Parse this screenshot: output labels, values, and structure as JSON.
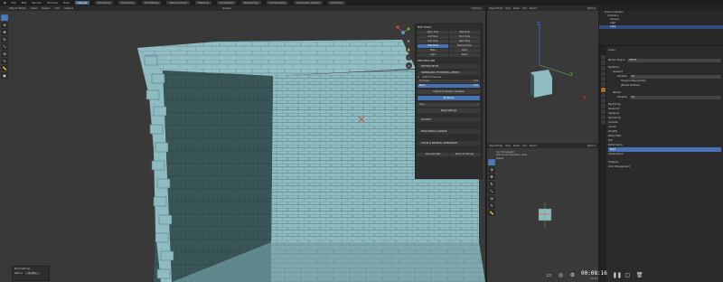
{
  "menubar": {
    "items": [
      "File",
      "Edit",
      "Render",
      "Window",
      "Help"
    ],
    "workspaces": [
      "Layout",
      "Modeling",
      "Sculpting",
      "UV Editing",
      "Texture Paint",
      "Shading",
      "Animation",
      "Rendering",
      "Compositing",
      "Geometry Nodes",
      "Scripting"
    ],
    "active_workspace": "Layout"
  },
  "viewport_main": {
    "mode": "Object Mode",
    "menus": [
      "View",
      "Select",
      "Add",
      "Object"
    ],
    "orientation": "Global",
    "options": "Options"
  },
  "npanel": {
    "title": "MAP TOOLS",
    "tool_buttons": [
      "Open Tools",
      "Wall Tools",
      "Add Tools",
      "Brick Tools",
      "Mod Tools",
      "Weld Tools",
      "Wall Mods",
      "Material Tools",
      "Base",
      "Edge",
      "Light",
      "Select"
    ],
    "active_button": "Wall Mods",
    "category": "BRICKBUILDER",
    "sections": [
      "PATTERN SETUP",
      "DIMENSIONS (THICKNESS & BEVEL)",
      "SCATTER",
      "EDGE WEAR & DAMAGE",
      "COLOR & MATERIAL APPEARANCE"
    ],
    "fields": [
      {
        "label": "Thickness",
        "value": "0.15"
      },
      {
        "label": "Bevel",
        "value": "0.02"
      }
    ],
    "checkbox_label": "Uniform Thickness",
    "buttons": [
      "Custom Thickness / Variation",
      "Set Bevels",
      "Reset Settings"
    ],
    "seed_label": "Seed",
    "seed_value": "1",
    "footer_buttons": [
      "Generate Wall",
      "Reset All Settings"
    ]
  },
  "last_operator": {
    "title": "Bevel Settings",
    "field_label": "Method",
    "field_value": "Modifier"
  },
  "viewport_right_top": {
    "mode": "Object Mode",
    "menus": [
      "View",
      "Select",
      "Add",
      "Object"
    ],
    "options": "Options"
  },
  "viewport_right_bottom": {
    "mode": "Object Mode",
    "menus": [
      "View",
      "Select",
      "Add",
      "Object"
    ],
    "info_lines": [
      "Top Orthographic",
      "(28) Scene Collection | Cube",
      "Meters"
    ],
    "options": "Options"
  },
  "outliner": {
    "items": [
      "Scene Collection",
      "Collection",
      "Camera",
      "Light",
      "Cube"
    ],
    "selected": "Cube"
  },
  "properties": {
    "object_name": "Scene",
    "render_engine_label": "Render Engine",
    "render_engine": "EEVEE",
    "rows": [
      "Sampling",
      "Viewport",
      "Samples",
      "Temporal Reprojection",
      "Jittered Shadows",
      "Render",
      "Samples",
      "Raytracing",
      "Advanced",
      "Clamping",
      "Raytracing",
      "Volumes",
      "Curves",
      "Simplify",
      "Motion Blur",
      "Film",
      "Performance",
      "Bake",
      "Grease Pencil",
      "Freestyle",
      "Color Management"
    ],
    "samples_value": "16",
    "render_samples_value": "64",
    "highlight_index": 17
  },
  "overlay": {
    "time": "00:08:16",
    "fps": "20 fps"
  },
  "colors": {
    "accent": "#4772b3",
    "brick": "#89b4ba",
    "brick_dark": "#3e5a5c",
    "background": "#393939"
  }
}
